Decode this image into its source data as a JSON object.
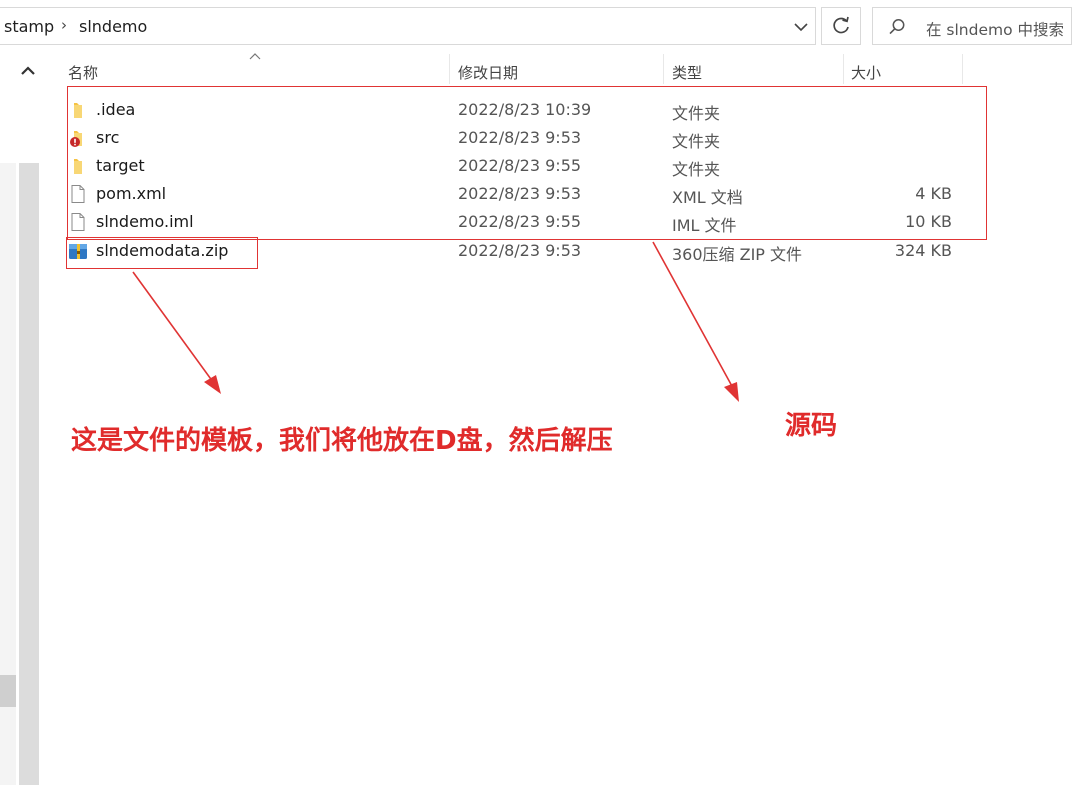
{
  "address_bar": {
    "breadcrumbs": [
      "stamp",
      "slndemo"
    ],
    "separator": "›",
    "dropdown_icon": "chevron-down-icon",
    "refresh_icon": "refresh-icon"
  },
  "search": {
    "placeholder": "在 slndemo 中搜索"
  },
  "columns": {
    "name": "名称",
    "modified": "修改日期",
    "type": "类型",
    "size": "大小"
  },
  "files": [
    {
      "name": ".idea",
      "modified": "2022/8/23 10:39",
      "type": "文件夹",
      "size": "",
      "icon": "folder-icon"
    },
    {
      "name": "src",
      "modified": "2022/8/23 9:53",
      "type": "文件夹",
      "size": "",
      "icon": "folder-error-icon"
    },
    {
      "name": "target",
      "modified": "2022/8/23 9:55",
      "type": "文件夹",
      "size": "",
      "icon": "folder-icon"
    },
    {
      "name": "pom.xml",
      "modified": "2022/8/23 9:53",
      "type": "XML 文档",
      "size": "4 KB",
      "icon": "document-icon"
    },
    {
      "name": "slndemo.iml",
      "modified": "2022/8/23 9:55",
      "type": "IML 文件",
      "size": "10 KB",
      "icon": "document-icon"
    },
    {
      "name": "slndemodata.zip",
      "modified": "2022/8/23 9:53",
      "type": "360压缩 ZIP 文件",
      "size": "324 KB",
      "icon": "zip-archive-icon"
    }
  ],
  "annotations": {
    "template_note": "这是文件的模板，我们将他放在D盘，然后解压",
    "source_note": "源码",
    "color": "#e02b2b"
  }
}
